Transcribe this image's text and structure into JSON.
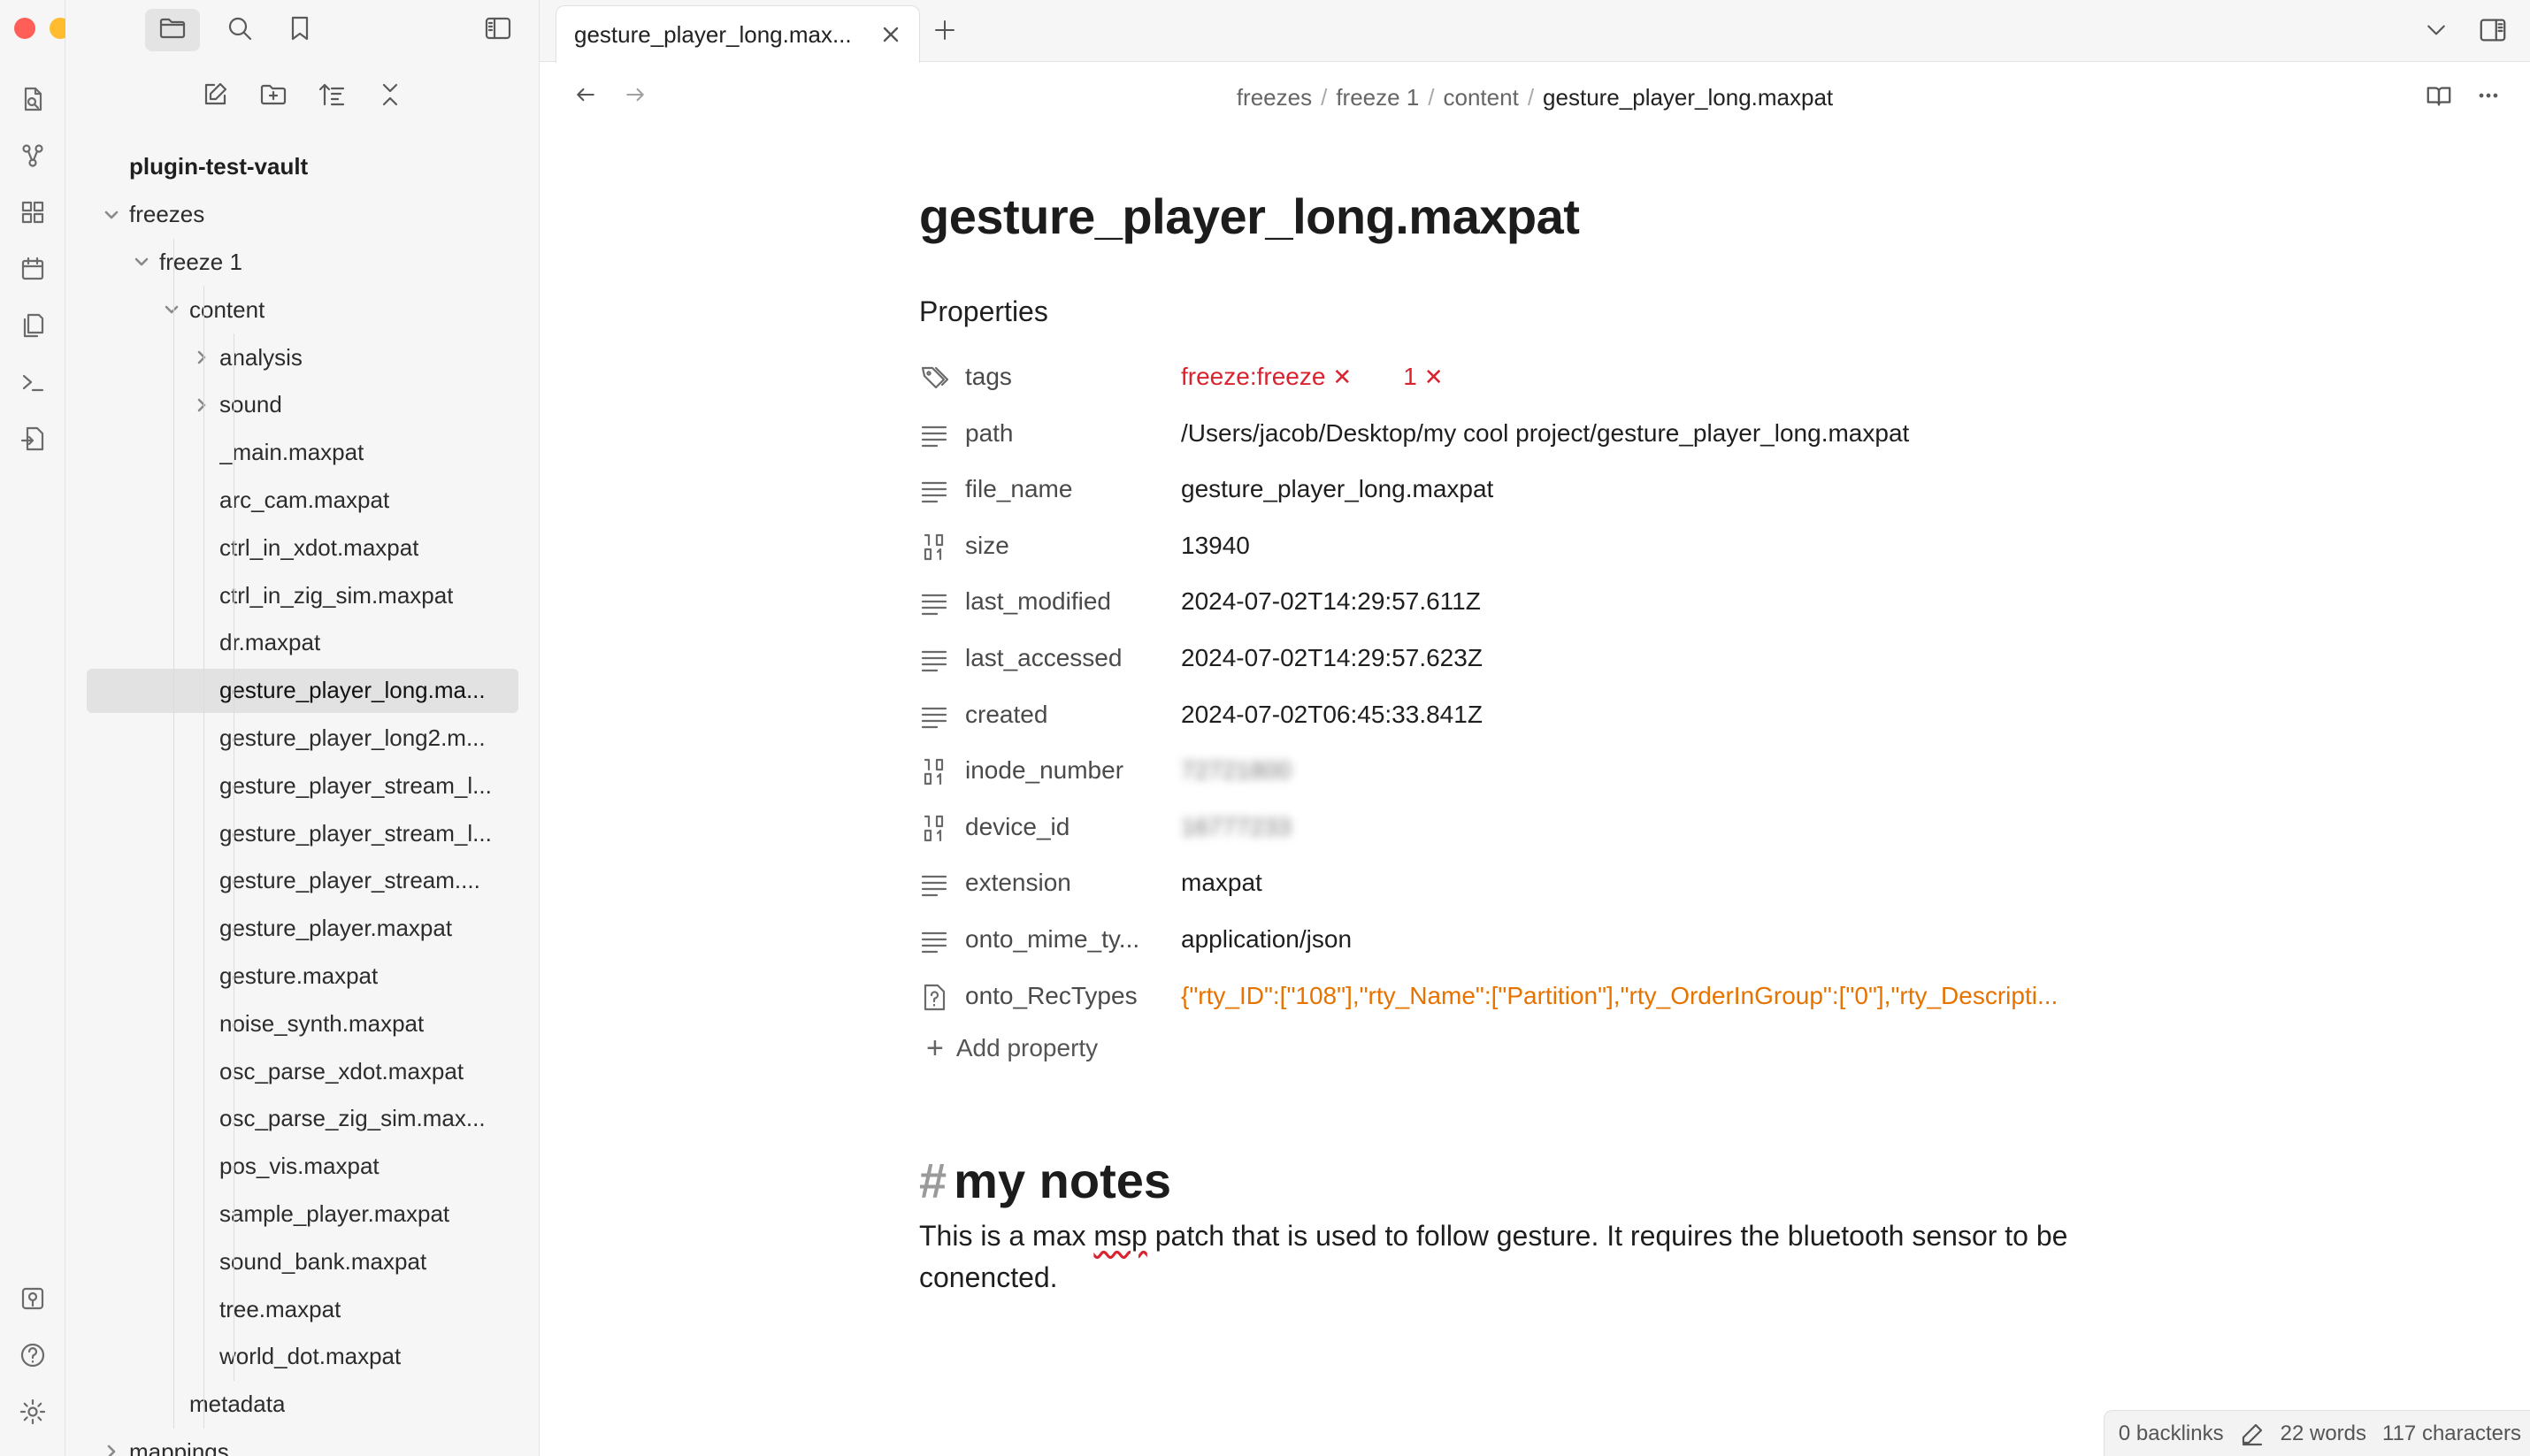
{
  "window": {
    "traffic_colors": {
      "close": "#ff5f57",
      "minimize": "#febc2e",
      "maximize": "#28c840"
    }
  },
  "ribbon": {
    "top_icons": [
      "open-quick-switcher-icon",
      "graph-view-icon",
      "canvas-icon",
      "daily-note-icon",
      "templates-icon",
      "command-palette-icon",
      "import-icon"
    ],
    "bottom_icons": [
      "open-vault-icon",
      "help-icon",
      "settings-icon"
    ]
  },
  "sidebar": {
    "top_icons": [
      "folder-icon",
      "search-icon",
      "bookmark-icon",
      "sidebar-toggle-icon"
    ],
    "file_toolbar": [
      "new-note-icon",
      "new-folder-icon",
      "sort-icon",
      "collapse-all-icon"
    ],
    "vault_name": "plugin-test-vault",
    "tree": [
      {
        "label": "freezes",
        "depth": 0,
        "chevron": "down"
      },
      {
        "label": "freeze 1",
        "depth": 1,
        "chevron": "down"
      },
      {
        "label": "content",
        "depth": 2,
        "chevron": "down"
      },
      {
        "label": "analysis",
        "depth": 3,
        "chevron": "right"
      },
      {
        "label": "sound",
        "depth": 3,
        "chevron": "right"
      },
      {
        "label": "_main.maxpat",
        "depth": 3
      },
      {
        "label": "arc_cam.maxpat",
        "depth": 3
      },
      {
        "label": "ctrl_in_xdot.maxpat",
        "depth": 3
      },
      {
        "label": "ctrl_in_zig_sim.maxpat",
        "depth": 3
      },
      {
        "label": "dr.maxpat",
        "depth": 3
      },
      {
        "label": "gesture_player_long.ma...",
        "depth": 3,
        "selected": true
      },
      {
        "label": "gesture_player_long2.m...",
        "depth": 3
      },
      {
        "label": "gesture_player_stream_l...",
        "depth": 3
      },
      {
        "label": "gesture_player_stream_l...",
        "depth": 3
      },
      {
        "label": "gesture_player_stream....",
        "depth": 3
      },
      {
        "label": "gesture_player.maxpat",
        "depth": 3
      },
      {
        "label": "gesture.maxpat",
        "depth": 3
      },
      {
        "label": "noise_synth.maxpat",
        "depth": 3
      },
      {
        "label": "osc_parse_xdot.maxpat",
        "depth": 3
      },
      {
        "label": "osc_parse_zig_sim.max...",
        "depth": 3
      },
      {
        "label": "pos_vis.maxpat",
        "depth": 3
      },
      {
        "label": "sample_player.maxpat",
        "depth": 3
      },
      {
        "label": "sound_bank.maxpat",
        "depth": 3
      },
      {
        "label": "tree.maxpat",
        "depth": 3
      },
      {
        "label": "world_dot.maxpat",
        "depth": 3
      },
      {
        "label": "metadata",
        "depth": 2
      },
      {
        "label": "mappings",
        "depth": 0,
        "chevron": "right"
      }
    ]
  },
  "tabs": {
    "active_label": "gesture_player_long.max..."
  },
  "breadcrumb": {
    "parts": [
      "freezes",
      "freeze 1",
      "content"
    ],
    "current": "gesture_player_long.maxpat"
  },
  "document": {
    "title": "gesture_player_long.maxpat",
    "properties_heading": "Properties",
    "properties": [
      {
        "key": "tags",
        "icon": "tags-icon",
        "type": "tags",
        "tags": [
          "freeze:freeze",
          "1"
        ]
      },
      {
        "key": "path",
        "icon": "text-icon",
        "value": "/Users/jacob/Desktop/my cool project/gesture_player_long.maxpat"
      },
      {
        "key": "file_name",
        "icon": "text-icon",
        "value": "gesture_player_long.maxpat"
      },
      {
        "key": "size",
        "icon": "number-icon",
        "value": "13940"
      },
      {
        "key": "last_modified",
        "icon": "text-icon",
        "value": "2024-07-02T14:29:57.611Z"
      },
      {
        "key": "last_accessed",
        "icon": "text-icon",
        "value": "2024-07-02T14:29:57.623Z"
      },
      {
        "key": "created",
        "icon": "text-icon",
        "value": "2024-07-02T06:45:33.841Z"
      },
      {
        "key": "inode_number",
        "icon": "number-icon",
        "value": "72721800",
        "blurred": true
      },
      {
        "key": "device_id",
        "icon": "number-icon",
        "value": "16777233",
        "blurred": true
      },
      {
        "key": "extension",
        "icon": "text-icon",
        "value": "maxpat"
      },
      {
        "key": "onto_mime_ty...",
        "icon": "text-icon",
        "value": "application/json"
      },
      {
        "key": "onto_RecTypes",
        "icon": "unknown-icon",
        "value": "{\"rty_ID\":[\"108\"],\"rty_Name\":[\"Partition\"],\"rty_OrderInGroup\":[\"0\"],\"rty_Descripti...",
        "style": "orange"
      }
    ],
    "add_property_label": "Add property",
    "heading_hash": "#",
    "heading": "my notes",
    "paragraph_before": "This is a max ",
    "paragraph_misspelled": "msp",
    "paragraph_after": " patch that is used to follow gesture. It requires the bluetooth sensor to be conencted."
  },
  "status": {
    "backlinks": "0 backlinks",
    "words": "22 words",
    "characters": "117 characters"
  },
  "colors": {
    "tag": "#d9232f",
    "orange_value": "#e67300",
    "sidebar_bg": "#f6f6f6",
    "selected_row": "#e2e2e2"
  }
}
